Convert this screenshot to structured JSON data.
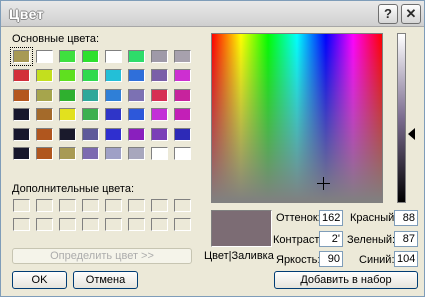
{
  "window": {
    "title": "Цвет",
    "help_glyph": "?",
    "close_glyph": "✕"
  },
  "basic_colors_label": "Основные цвета:",
  "basic_colors": [
    [
      "#a89a54",
      "#ffffff",
      "#3fe03f",
      "#2ee02e",
      "#ffffff",
      "#2edc6a",
      "#9f9aa8",
      "#a7a1ad"
    ],
    [
      "#d22f3a",
      "#c3df1e",
      "#5fe01f",
      "#2fda4d",
      "#23bfd7",
      "#2f6fda",
      "#7a5fa8",
      "#cd2fd1"
    ],
    [
      "#b4571e",
      "#a6a54c",
      "#2fb02f",
      "#2ea89a",
      "#2f7fd7",
      "#7c71b3",
      "#d62f53",
      "#c7239d"
    ],
    [
      "#17172c",
      "#a46a2a",
      "#e2e11e",
      "#3db04f",
      "#2f35c8",
      "#2d58da",
      "#c32fd7",
      "#c31fb7"
    ],
    [
      "#17172c",
      "#b0561e",
      "#1a1a2c",
      "#5e5a9a",
      "#2f2fcf",
      "#8a1fbe",
      "#7a3fb7",
      "#2d2ab7"
    ],
    [
      "#17172c",
      "#b0561e",
      "#a89a54",
      "#7c6ab0",
      "#9fa0c6",
      "#a8a7bd",
      "#ffffff"
    ]
  ],
  "custom_colors_label": "Дополнительные цвета:",
  "define_custom_button": "Определить цвет >>",
  "ok_button": "OK",
  "cancel_button": "Отмена",
  "preview": {
    "color": "#7c6c74",
    "label": "Цвет|Заливка"
  },
  "fields": {
    "hue_label": "Оттенок:",
    "hue": "162",
    "sat_label": "Контраст:",
    "sat": "2'",
    "lum_label": "Яркость:",
    "lum": "90",
    "red_label": "Красный:",
    "red": "88",
    "green_label": "Зеленый:",
    "green": "87",
    "blue_label": "Синий:",
    "blue": "104"
  },
  "add_to_custom_button": "Добавить в набор"
}
